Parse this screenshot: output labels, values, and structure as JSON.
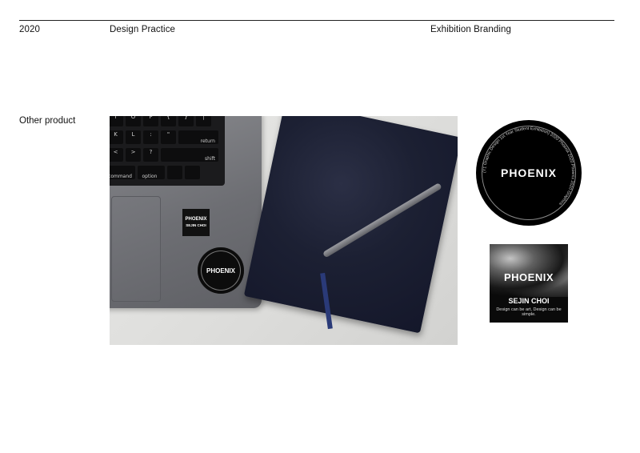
{
  "header": {
    "year": "2020",
    "category": "Design Practice",
    "project": "Exhibition Branding"
  },
  "section": {
    "label": "Other product"
  },
  "photo": {
    "keys_row1": [
      "I",
      "O",
      "P",
      "{",
      "}",
      "|"
    ],
    "keys_row2": [
      "K",
      "L",
      ":",
      "\""
    ],
    "key_return": "return",
    "keys_row3": [
      "<",
      ">",
      "?"
    ],
    "key_shift": "shift",
    "key_command": "command",
    "key_option": "option",
    "laptop_square_sticker_text": "PHOENIX",
    "laptop_square_sticker_sub": "SEJIN CHOI",
    "laptop_round_sticker_text": "PHOENIX"
  },
  "round_sticker": {
    "name": "PHOENIX",
    "ring_text": "(Y1 Graphic Design 1st Year Student Exhibition) 2020 Phoenix 2020 Phoenix 2020 Graphics"
  },
  "square_sticker": {
    "name": "PHOENIX",
    "designer": "SEJIN CHOI",
    "tagline": "Design can be art, Design can be simple."
  }
}
